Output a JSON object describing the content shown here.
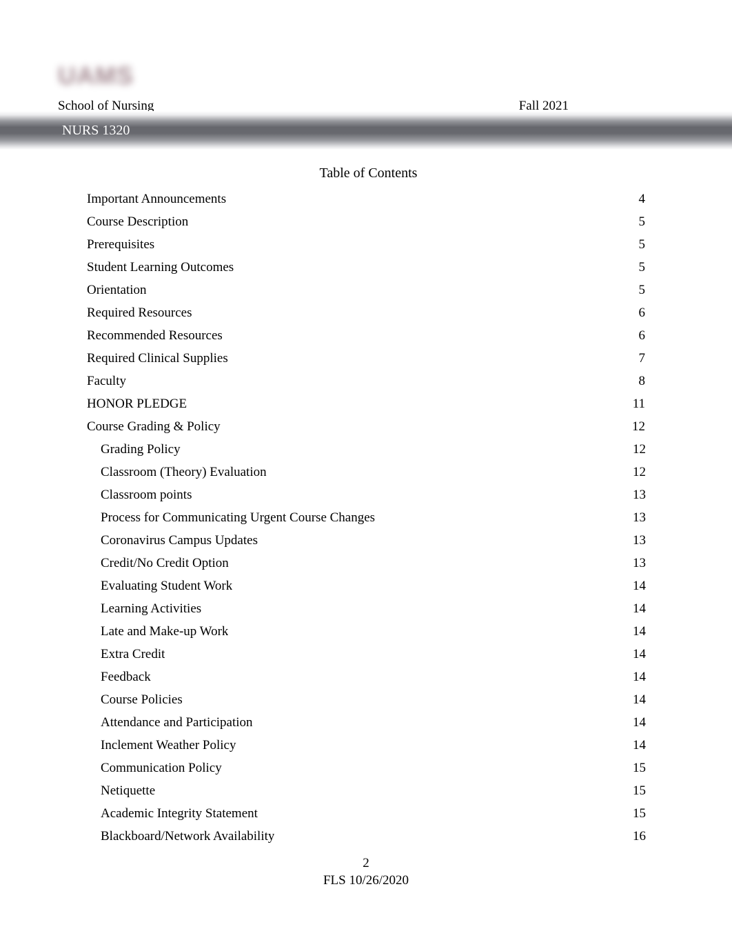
{
  "header": {
    "logo_text": "UAMS",
    "logo_color": "#9d8189",
    "school_name": "School of Nursing",
    "term": "Fall 2021",
    "course_code": "NURS 1320",
    "band_color": "#65666c"
  },
  "toc": {
    "title": "Table of Contents",
    "entries": [
      {
        "label": "Important Announcements",
        "page": "4",
        "level": 1
      },
      {
        "label": "Course Description",
        "page": "5",
        "level": 1
      },
      {
        "label": "Prerequisites",
        "page": "5",
        "level": 1
      },
      {
        "label": "Student Learning Outcomes",
        "page": "5",
        "level": 1
      },
      {
        "label": "Orientation",
        "page": "5",
        "level": 1
      },
      {
        "label": "Required Resources",
        "page": "6",
        "level": 1
      },
      {
        "label": "Recommended Resources",
        "page": "6",
        "level": 1
      },
      {
        "label": "Required Clinical Supplies",
        "page": "7",
        "level": 1
      },
      {
        "label": "Faculty",
        "page": "8",
        "level": 1
      },
      {
        "label": "HONOR PLEDGE",
        "page": "11",
        "level": 1
      },
      {
        "label": "Course Grading & Policy",
        "page": "12",
        "level": 1
      },
      {
        "label": "Grading Policy",
        "page": "12",
        "level": 2
      },
      {
        "label": "Classroom (Theory) Evaluation",
        "page": "12",
        "level": 2
      },
      {
        "label": "Classroom points",
        "page": "13",
        "level": 2
      },
      {
        "label": "Process for Communicating Urgent Course Changes",
        "page": "13",
        "level": 2
      },
      {
        "label": "Coronavirus Campus Updates",
        "page": "13",
        "level": 2
      },
      {
        "label": "Credit/No Credit Option",
        "page": "13",
        "level": 2
      },
      {
        "label": "Evaluating Student Work",
        "page": "14",
        "level": 2
      },
      {
        "label": "Learning Activities",
        "page": "14",
        "level": 2
      },
      {
        "label": "Late and Make-up Work",
        "page": "14",
        "level": 2
      },
      {
        "label": "Extra Credit",
        "page": "14",
        "level": 2
      },
      {
        "label": "Feedback",
        "page": "14",
        "level": 2
      },
      {
        "label": "Course Policies",
        "page": "14",
        "level": 2
      },
      {
        "label": "Attendance and Participation",
        "page": "14",
        "level": 2
      },
      {
        "label": "Inclement Weather Policy",
        "page": "14",
        "level": 2
      },
      {
        "label": "Communication Policy",
        "page": "15",
        "level": 2
      },
      {
        "label": "Netiquette",
        "page": "15",
        "level": 2
      },
      {
        "label": "Academic Integrity Statement",
        "page": "15",
        "level": 2
      },
      {
        "label": "Blackboard/Network Availability",
        "page": "16",
        "level": 2
      }
    ]
  },
  "footer": {
    "page_number": "2",
    "revision": "FLS 10/26/2020"
  }
}
